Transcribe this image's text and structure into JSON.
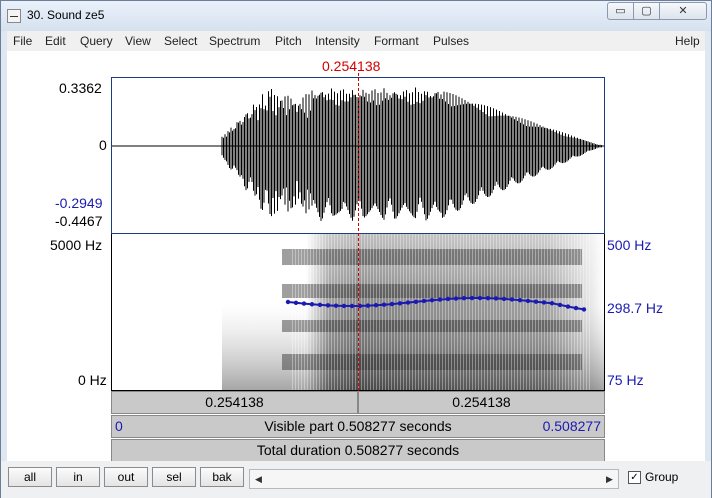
{
  "window": {
    "title": "30. Sound ze5",
    "minimize": "▭",
    "maximize": "▢",
    "close": "✕"
  },
  "menu": [
    "File",
    "Edit",
    "Query",
    "View",
    "Select",
    "Spectrum",
    "Pitch",
    "Intensity",
    "Formant",
    "Pulses",
    "Help"
  ],
  "cursor": {
    "time_label": "0.254138"
  },
  "waveform": {
    "max": "0.3362",
    "zero": "0",
    "cursor_value": "-0.2949",
    "min": "-0.4467"
  },
  "spectrogram": {
    "top_label": "5000 Hz",
    "bottom_label": "0 Hz"
  },
  "pitch": {
    "top_label": "500 Hz",
    "value_label": "298.7 Hz",
    "bottom_label": "75 Hz"
  },
  "time_bar": {
    "left": "0.254138",
    "right": "0.254138"
  },
  "visible_bar": {
    "start": "0",
    "text": "Visible part 0.508277 seconds",
    "end": "0.508277"
  },
  "total_bar": {
    "text": "Total duration 0.508277 seconds"
  },
  "buttons": {
    "all": "all",
    "in": "in",
    "out": "out",
    "sel": "sel",
    "bak": "bak"
  },
  "scroll": {
    "left_arrow": "◀",
    "right_arrow": "▶"
  },
  "group": {
    "label": "Group",
    "checked": "✓"
  }
}
